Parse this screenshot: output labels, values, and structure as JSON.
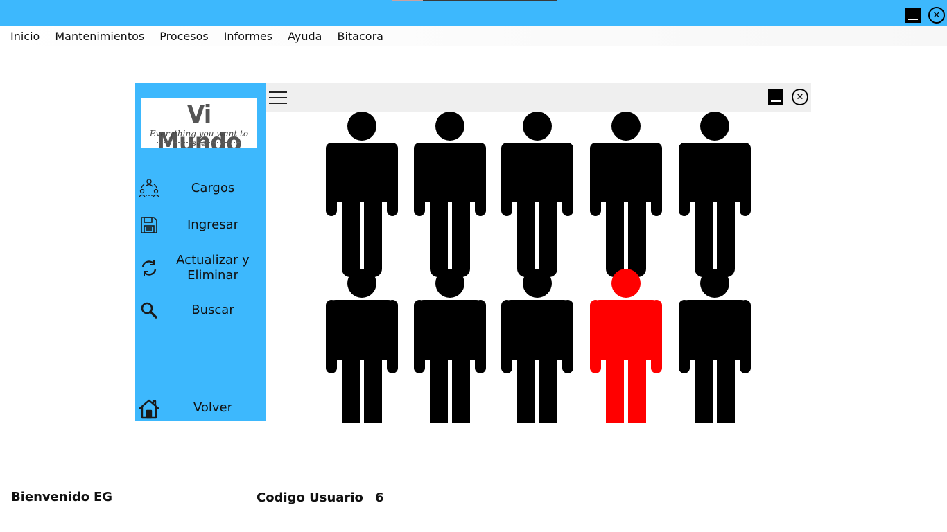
{
  "menu": [
    "Inicio",
    "Mantenimientos",
    "Procesos",
    "Informes",
    "Ayuda",
    "Bitacora"
  ],
  "logo": {
    "title": "Vi Mundo",
    "tagline": "Everything you want to see"
  },
  "sidebar": {
    "items": [
      {
        "label": "Cargos",
        "icon": "org-chart-icon"
      },
      {
        "label": "Ingresar",
        "icon": "save-icon"
      },
      {
        "label": "Actualizar y Eliminar",
        "icon": "refresh-icon"
      },
      {
        "label": "Buscar",
        "icon": "search-icon"
      },
      {
        "label": "Volver",
        "icon": "home-icon"
      }
    ]
  },
  "graphic": {
    "person_color": "#000000",
    "highlight_color": "#ff0000",
    "rows": 2,
    "columns": 5,
    "highlighted": [
      1,
      3
    ]
  },
  "status": {
    "welcome_label": "Bienvenido",
    "user_name": "EG",
    "user_code_label": "Codigo Usuario",
    "user_code": "6"
  },
  "colors": {
    "accent": "#3db8fd",
    "header_bg": "#efefef"
  }
}
